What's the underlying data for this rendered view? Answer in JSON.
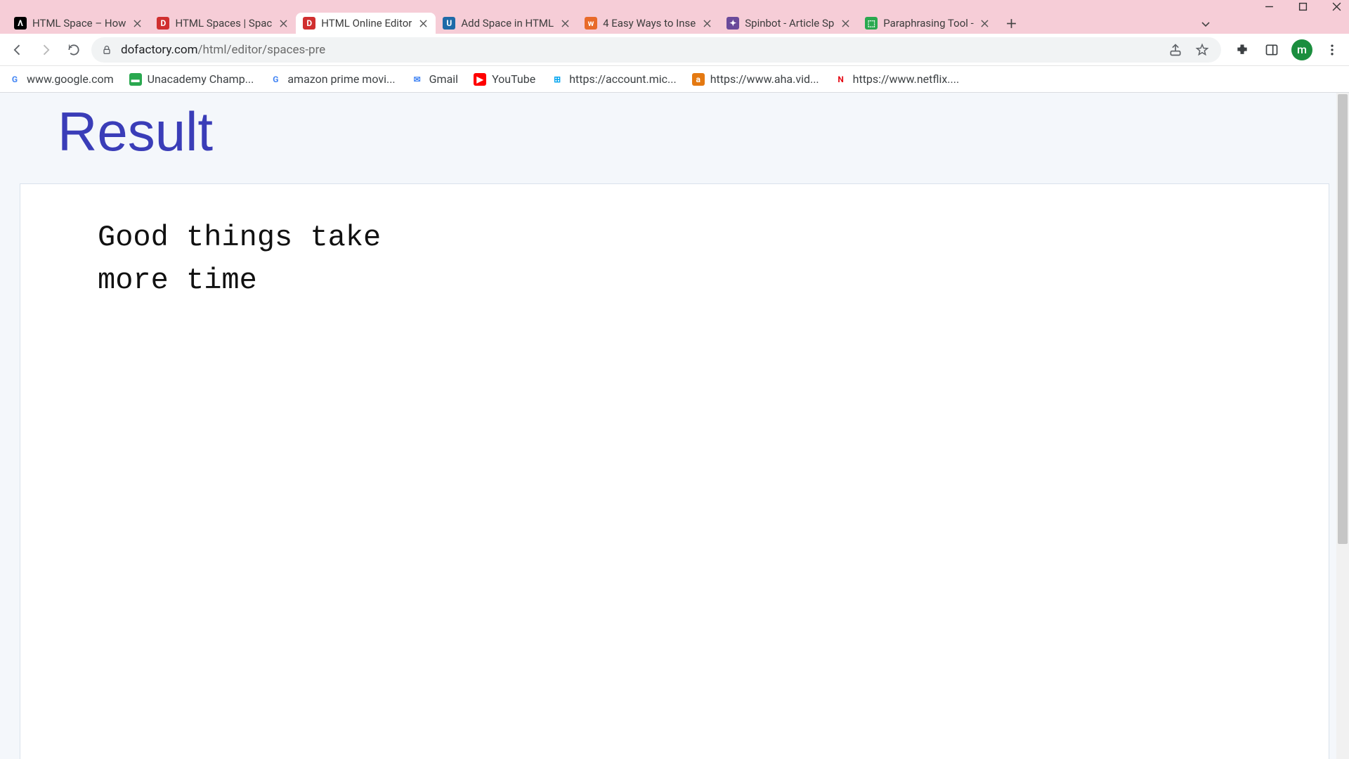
{
  "window_controls": {
    "minimize": "minimize",
    "maximize": "maximize",
    "close": "close"
  },
  "tabs": [
    {
      "label": "HTML Space – How",
      "favicon_bg": "#000000",
      "favicon_fg": "#ffffff",
      "favicon_text": "Λ"
    },
    {
      "label": "HTML Spaces | Spac",
      "favicon_bg": "#d02f2f",
      "favicon_fg": "#ffffff",
      "favicon_text": "D"
    },
    {
      "label": "HTML Online Editor",
      "favicon_bg": "#d02f2f",
      "favicon_fg": "#ffffff",
      "favicon_text": "D",
      "active": true
    },
    {
      "label": "Add Space in HTML",
      "favicon_bg": "#1e6aa8",
      "favicon_fg": "#ffffff",
      "favicon_text": "U"
    },
    {
      "label": "4 Easy Ways to Inse",
      "favicon_bg": "#e86a2a",
      "favicon_fg": "#ffffff",
      "favicon_text": "w"
    },
    {
      "label": "Spinbot - Article Sp",
      "favicon_bg": "#6a4a9a",
      "favicon_fg": "#ffffff",
      "favicon_text": "✦"
    },
    {
      "label": "Paraphrasing Tool -",
      "favicon_bg": "#2aa84f",
      "favicon_fg": "#ffffff",
      "favicon_text": "⬚"
    }
  ],
  "omnibox": {
    "domain": "dofactory.com",
    "path": "/html/editor/spaces-pre"
  },
  "avatar_letter": "m",
  "bookmarks": [
    {
      "label": "www.google.com",
      "icon_bg": "#ffffff",
      "icon_fg": "#4285f4",
      "icon_text": "G"
    },
    {
      "label": "Unacademy Champ...",
      "icon_bg": "#2aa84f",
      "icon_fg": "#ffffff",
      "icon_text": "▬"
    },
    {
      "label": "amazon prime movi...",
      "icon_bg": "#ffffff",
      "icon_fg": "#4285f4",
      "icon_text": "G"
    },
    {
      "label": "Gmail",
      "icon_bg": "#ffffff",
      "icon_fg": "#4285f4",
      "icon_text": "✉"
    },
    {
      "label": "YouTube",
      "icon_bg": "#ff0000",
      "icon_fg": "#ffffff",
      "icon_text": "▶"
    },
    {
      "label": "https://account.mic...",
      "icon_bg": "#ffffff",
      "icon_fg": "#00a4ef",
      "icon_text": "⊞"
    },
    {
      "label": "https://www.aha.vid...",
      "icon_bg": "#e47911",
      "icon_fg": "#ffffff",
      "icon_text": "a"
    },
    {
      "label": "https://www.netflix....",
      "icon_bg": "#ffffff",
      "icon_fg": "#e50914",
      "icon_text": "N"
    }
  ],
  "page": {
    "heading": "Result",
    "pre_text": "Good things take\nmore time"
  }
}
